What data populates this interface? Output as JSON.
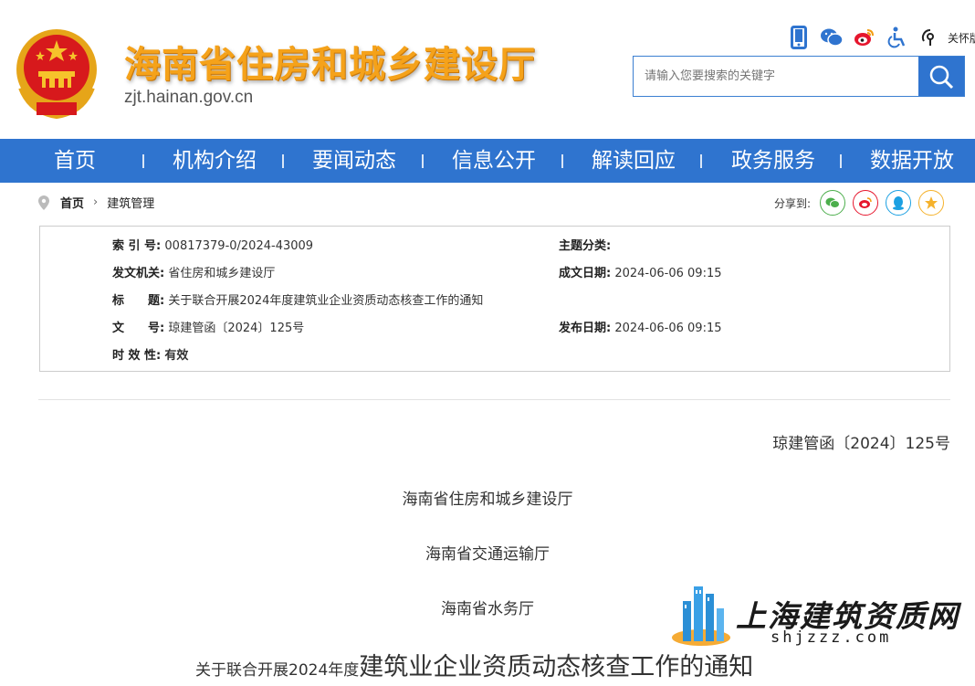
{
  "header": {
    "site_title": "海南省住房和城乡建设厅",
    "site_domain": "zjt.hainan.gov.cn",
    "care_mode_label": "关怀版",
    "search_placeholder": "请输入您要搜索的关键字",
    "icons": [
      "mobile-icon",
      "wechat-icon",
      "weibo-icon",
      "accessibility-icon",
      "care-mode-icon"
    ]
  },
  "nav": {
    "items": [
      "首页",
      "机构介绍",
      "要闻动态",
      "信息公开",
      "解读回应",
      "政务服务",
      "数据开放"
    ]
  },
  "breadcrumb": {
    "home": "首页",
    "current": "建筑管理"
  },
  "share": {
    "label": "分享到:",
    "targets": [
      "wechat-icon",
      "weibo-icon",
      "qq-icon",
      "qzone-icon"
    ]
  },
  "meta": {
    "index_key": "索 引 号:",
    "index_value": "00817379-0/2024-43009",
    "topic_key": "主题分类:",
    "topic_value": "",
    "issuer_key": "发文机关:",
    "issuer_value": "省住房和城乡建设厅",
    "created_key": "成文日期:",
    "created_value": "2024-06-06 09:15",
    "title_key": "标　　题:",
    "title_value": "关于联合开展2024年度建筑业企业资质动态核查工作的通知",
    "docno_key": "文　　号:",
    "docno_value": "琼建管函〔2024〕125号",
    "published_key": "发布日期:",
    "published_value": "2024-06-06 09:15",
    "validity_key": "时 效 性:",
    "validity_value": "有效"
  },
  "article": {
    "doc_number": "琼建管函〔2024〕125号",
    "recipients": [
      "海南省住房和城乡建设厅",
      "海南省交通运输厅",
      "海南省水务厅"
    ],
    "title_small": "关于联合开展2024年度",
    "title_big": "建筑业企业资质动态核查工作的通知"
  },
  "watermark": {
    "name": "上海建筑资质网",
    "domain": "shjzzz.com"
  },
  "colors": {
    "primary": "#2f74cf",
    "title_gold": "#f5a21a",
    "emblem_red": "#d7191c"
  }
}
